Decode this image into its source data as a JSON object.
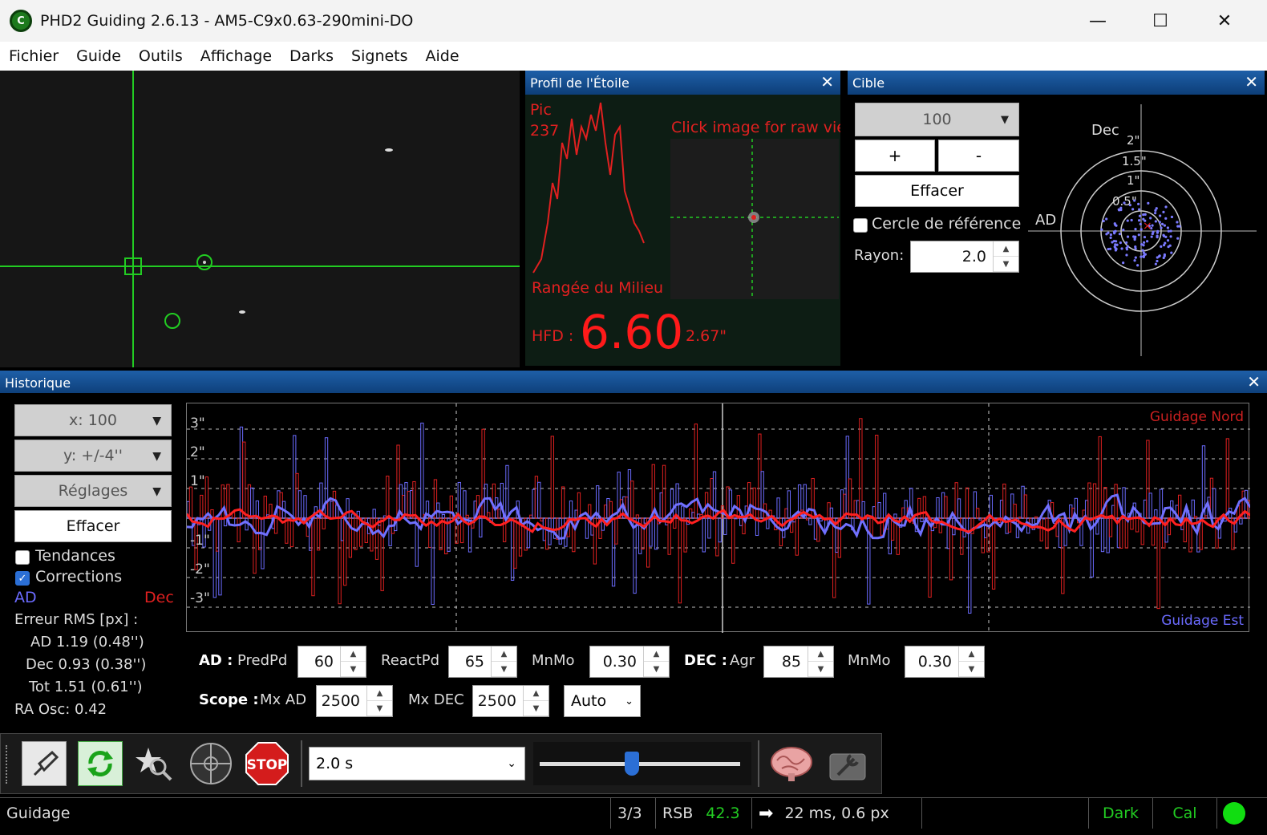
{
  "window": {
    "title": "PHD2 Guiding 2.6.13 - AM5-C9x0.63-290mini-DO",
    "app_icon_letter": "C",
    "minimize": "—",
    "maximize": "☐",
    "close": "✕"
  },
  "menu": [
    "Fichier",
    "Guide",
    "Outils",
    "Affichage",
    "Darks",
    "Signets",
    "Aide"
  ],
  "profile": {
    "title": "Profil de l'Étoile",
    "pic_label": "Pic",
    "pic_value": "237",
    "click_hint": "Click image for raw vie",
    "row_label": "Rangée du Milieu",
    "hfd_label": "HFD :",
    "hfd_value": "6.60",
    "hfd_arcsec": "2.67\"",
    "close": "✕"
  },
  "target": {
    "title": "Cible",
    "zoom_value": "100",
    "plus": "+",
    "minus": "-",
    "clear": "Effacer",
    "ref_circle_label": "Cercle de référence",
    "radius_label": "Rayon:",
    "radius_value": "2.0",
    "dec_label": "Dec",
    "ad_label": "AD",
    "ring_labels": [
      "2\"",
      "1.5\"",
      "1\"",
      "0.5\""
    ],
    "close": "✕"
  },
  "history": {
    "title": "Historique",
    "close": "✕",
    "x_scale": "x: 100",
    "y_scale": "y: +/-4''",
    "settings": "Réglages",
    "clear": "Effacer",
    "trends_label": "Tendances",
    "corrections_label": "Corrections",
    "ad_legend": "AD",
    "dec_legend": "Dec",
    "rms_title": "Erreur RMS [px] :",
    "rms_ad": "AD  1.19 (0.48'')",
    "rms_dec": "Dec  0.93 (0.38'')",
    "rms_tot": "Tot  1.51 (0.61'')",
    "ra_osc": "RA Osc: 0.42",
    "guide_north": "Guidage Nord",
    "guide_east": "Guidage Est",
    "y_ticks": [
      "3\"",
      "2\"",
      "1\"",
      "-1\"",
      "-2\"",
      "-3\""
    ],
    "params": {
      "ad_label": "AD :",
      "predpd_label": "PredPd",
      "predpd_value": "60",
      "reactpd_label": "ReactPd",
      "reactpd_value": "65",
      "mnmo_label": "MnMo",
      "mnmo_ad_value": "0.30",
      "dec_label": "DEC :",
      "agr_label": "Agr",
      "agr_value": "85",
      "mnmo_dec_value": "0.30",
      "scope_label": "Scope :",
      "mxad_label": "Mx AD",
      "mxad_value": "2500",
      "mxdec_label": "Mx DEC",
      "mxdec_value": "2500",
      "mode_value": "Auto"
    }
  },
  "toolbar": {
    "exposure": "2.0 s",
    "exposure_slider_fraction": 0.46,
    "stop_label": "STOP"
  },
  "status": {
    "state": "Guidage",
    "frames": "3/3",
    "snr_label": "RSB",
    "snr_value": "42.3",
    "pulse": "22 ms, 0.6 px",
    "dark": "Dark",
    "cal": "Cal"
  },
  "colors": {
    "ra": "#6b6bff",
    "dec": "#e02020",
    "guide_line": "#22cc22",
    "panel_head": "#1e5fa8"
  }
}
